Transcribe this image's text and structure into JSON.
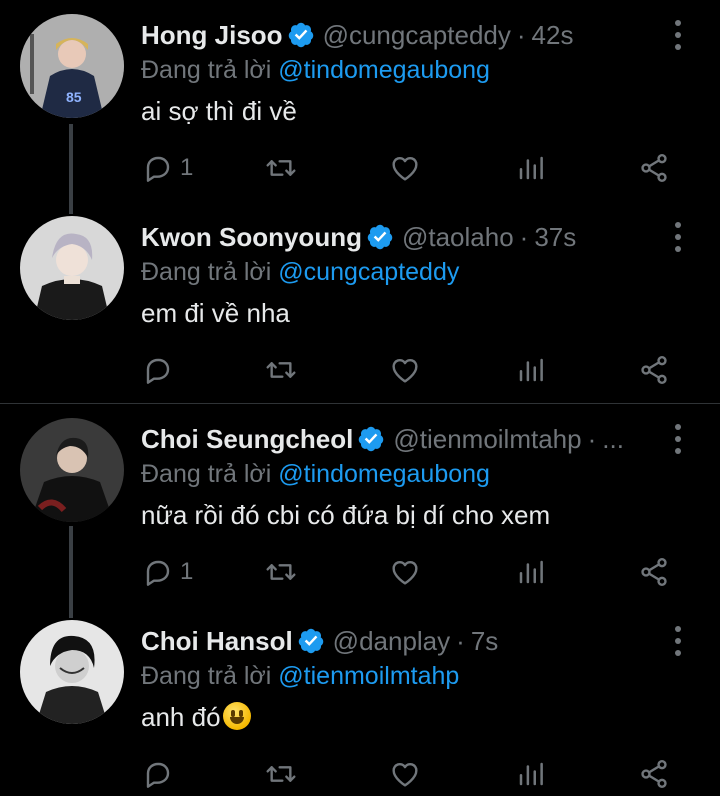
{
  "colors": {
    "background": "#000000",
    "accent": "#1d9bf0",
    "muted": "#71767b",
    "text": "#e7e9ea"
  },
  "reply_prefix": "Đang trả lời",
  "tweets": [
    {
      "name": "Hong Jisoo",
      "handle": "@cungcapteddy",
      "separator": "·",
      "time": "42s",
      "reply_to": "@tindomegaubong",
      "text": "ai sợ thì đi về",
      "reply_count": "1"
    },
    {
      "name": "Kwon Soonyoung",
      "handle": "@taolaho",
      "separator": "·",
      "time": "37s",
      "reply_to": "@cungcapteddy",
      "text": "em đi về nha",
      "reply_count": ""
    },
    {
      "name": "Choi Seungcheol",
      "handle": "@tienmoilmtahp",
      "separator": "·",
      "time": "...",
      "reply_to": "@tindomegaubong",
      "text": "nữa rồi đó cbi có đứa bị dí cho xem",
      "reply_count": "1"
    },
    {
      "name": "Choi Hansol",
      "handle": "@danplay",
      "separator": "·",
      "time": "7s",
      "reply_to": "@tienmoilmtahp",
      "text": "anh đó",
      "reply_count": ""
    }
  ],
  "icons": [
    "verified-badge-icon",
    "more-vertical-icon",
    "reply-icon",
    "retweet-icon",
    "like-icon",
    "analytics-icon",
    "share-icon",
    "grinning-emoji"
  ]
}
